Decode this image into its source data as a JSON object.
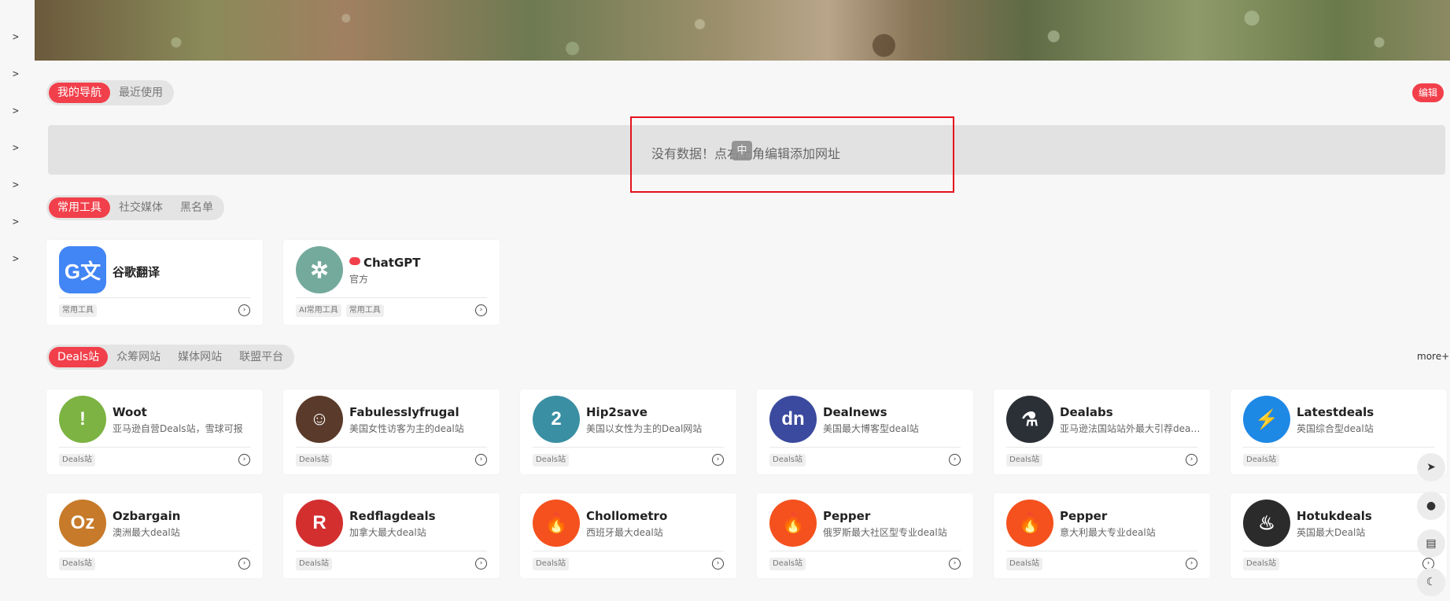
{
  "sidebar": {
    "chevrons": [
      ">",
      ">",
      ">",
      ">",
      ">",
      ">",
      ">",
      ">"
    ]
  },
  "nav": {
    "tabs": [
      {
        "label": "我的导航",
        "active": true
      },
      {
        "label": "最近使用",
        "active": false
      }
    ],
    "edit_label": "编辑",
    "empty_message": "没有数据！点右上角编辑添加网址",
    "ime_indicator": "中"
  },
  "tools": {
    "tabs": [
      {
        "label": "常用工具",
        "active": true
      },
      {
        "label": "社交媒体",
        "active": false
      },
      {
        "label": "黑名单",
        "active": false
      }
    ],
    "cards": [
      {
        "title": "谷歌翻译",
        "subtitle": "",
        "tags": [
          "常用工具"
        ],
        "logo_icon": "google-translate-icon",
        "logo_color": "#4285f4"
      },
      {
        "title": "ChatGPT",
        "subtitle": "官方",
        "tags": [
          "AI常用工具",
          "常用工具"
        ],
        "logo_icon": "chatgpt-icon",
        "logo_color": "#74aa9c",
        "badge": true
      }
    ]
  },
  "deals": {
    "tabs": [
      {
        "label": "Deals站",
        "active": true
      },
      {
        "label": "众筹网站",
        "active": false
      },
      {
        "label": "媒体网站",
        "active": false
      },
      {
        "label": "联盟平台",
        "active": false
      }
    ],
    "more_label": "more+",
    "cards": [
      {
        "title": "Woot",
        "subtitle": "亚马逊自营Deals站，雪球可报",
        "tag": "Deals站",
        "logo_icon": "woot-exclamation-icon",
        "logo_color": "#7cb342"
      },
      {
        "title": "Fabulesslyfrugal",
        "subtitle": "美国女性访客为主的deal站",
        "tag": "Deals站",
        "logo_icon": "fabulesslyfrugal-portrait-icon",
        "logo_color": "#5a3a2a"
      },
      {
        "title": "Hip2save",
        "subtitle": "美国以女性为主的Deal网站",
        "tag": "Deals站",
        "logo_icon": "hip2save-icon",
        "logo_color": "#3a8fa3"
      },
      {
        "title": "Dealnews",
        "subtitle": "美国最大博客型deal站",
        "tag": "Deals站",
        "logo_icon": "dealnews-dn-icon",
        "logo_color": "#3b4a9e"
      },
      {
        "title": "Dealabs",
        "subtitle": "亚马逊法国站站外最大引荐deal站",
        "tag": "Deals站",
        "logo_icon": "dealabs-flask-icon",
        "logo_color": "#2b2f36"
      },
      {
        "title": "Latestdeals",
        "subtitle": "英国综合型deal站",
        "tag": "Deals站",
        "logo_icon": "latestdeals-bolt-icon",
        "logo_color": "#1e88e5"
      },
      {
        "title": "Ozbargain",
        "subtitle": "澳洲最大deal站",
        "tag": "Deals站",
        "logo_icon": "ozbargain-oz-icon",
        "logo_color": "#c77a2a"
      },
      {
        "title": "Redflagdeals",
        "subtitle": "加拿大最大deal站",
        "tag": "Deals站",
        "logo_icon": "redflagdeals-r-icon",
        "logo_color": "#d32f2f"
      },
      {
        "title": "Chollometro",
        "subtitle": "西班牙最大deal站",
        "tag": "Deals站",
        "logo_icon": "pepper-flame-icon",
        "logo_color": "#f4511e"
      },
      {
        "title": "Pepper",
        "subtitle": "俄罗斯最大社区型专业deal站",
        "tag": "Deals站",
        "logo_icon": "pepper-flame-icon",
        "logo_color": "#f4511e"
      },
      {
        "title": "Pepper",
        "subtitle": "意大利最大专业deal站",
        "tag": "Deals站",
        "logo_icon": "pepper-flame-icon",
        "logo_color": "#f4511e"
      },
      {
        "title": "Hotukdeals",
        "subtitle": "英国最大Deal站",
        "tag": "Deals站",
        "logo_icon": "hotukdeals-flame-icon",
        "logo_color": "#2b2b2b"
      }
    ]
  },
  "floating": [
    {
      "name": "back-to-top-icon",
      "glyph": "➤"
    },
    {
      "name": "chat-icon",
      "glyph": "●"
    },
    {
      "name": "calculator-icon",
      "glyph": "▤"
    },
    {
      "name": "dark-mode-icon",
      "glyph": "☾"
    }
  ]
}
